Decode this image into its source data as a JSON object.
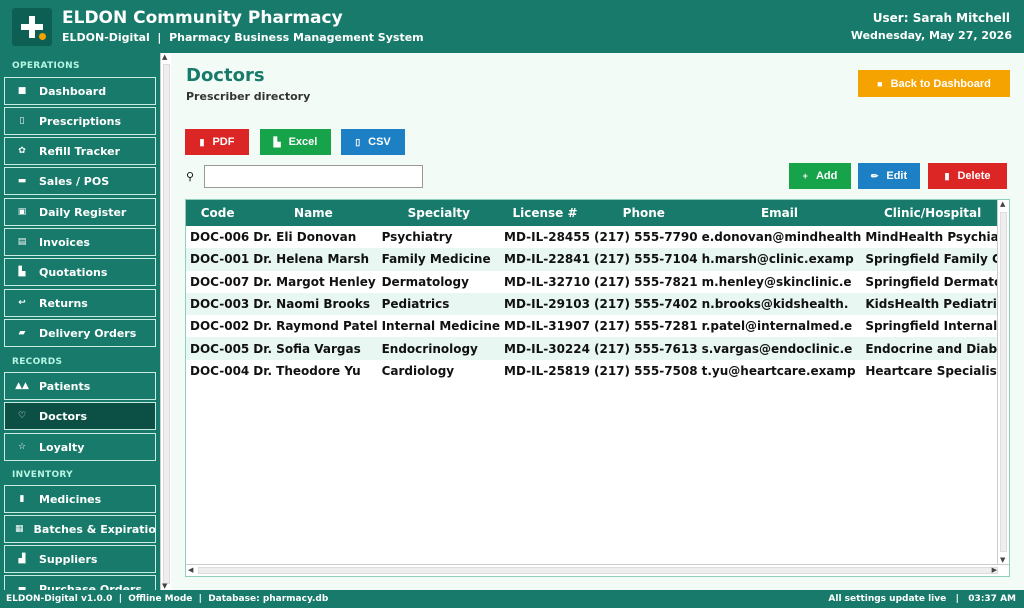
{
  "header": {
    "title": "ELDON Community Pharmacy",
    "subtitle": "ELDON-Digital  |  Pharmacy Business Management System",
    "user": "User: Sarah Mitchell",
    "date": "Wednesday, May 27, 2026",
    "logo_icon": "plus-cross-icon"
  },
  "sidebar": {
    "sections": [
      {
        "label": "OPERATIONS",
        "items": [
          {
            "icon": "home-icon",
            "glyph": "■",
            "label": "Dashboard"
          },
          {
            "icon": "clipboard-icon",
            "glyph": "▯",
            "label": "Prescriptions"
          },
          {
            "icon": "refill-icon",
            "glyph": "✿",
            "label": "Refill Tracker"
          },
          {
            "icon": "card-icon",
            "glyph": "▬",
            "label": "Sales / POS"
          },
          {
            "icon": "register-icon",
            "glyph": "▣",
            "label": "Daily Register"
          },
          {
            "icon": "invoice-icon",
            "glyph": "▤",
            "label": "Invoices"
          },
          {
            "icon": "quote-icon",
            "glyph": "▙",
            "label": "Quotations"
          },
          {
            "icon": "return-icon",
            "glyph": "↩",
            "label": "Returns"
          },
          {
            "icon": "truck-icon",
            "glyph": "▰",
            "label": "Delivery Orders"
          }
        ]
      },
      {
        "label": "RECORDS",
        "items": [
          {
            "icon": "users-icon",
            "glyph": "▲▲",
            "label": "Patients"
          },
          {
            "icon": "stethoscope-icon",
            "glyph": "♡",
            "label": "Doctors"
          },
          {
            "icon": "star-icon",
            "glyph": "☆",
            "label": "Loyalty"
          }
        ]
      },
      {
        "label": "INVENTORY",
        "items": [
          {
            "icon": "pill-icon",
            "glyph": "▮",
            "label": "Medicines"
          },
          {
            "icon": "batch-icon",
            "glyph": "▦",
            "label": "Batches & Expiratio"
          },
          {
            "icon": "factory-icon",
            "glyph": "▟",
            "label": "Suppliers"
          },
          {
            "icon": "cart-icon",
            "glyph": "▬",
            "label": "Purchase Orders"
          }
        ]
      }
    ],
    "active": "Doctors"
  },
  "main": {
    "title": "Doctors",
    "subtitle": "Prescriber directory",
    "back_label": "Back to Dashboard",
    "export": [
      {
        "label": "PDF",
        "color": "#dc2626"
      },
      {
        "label": "Excel",
        "color": "#16a34a"
      },
      {
        "label": "CSV",
        "color": "#1d7fc4"
      }
    ],
    "search": {
      "value": "",
      "placeholder": ""
    },
    "actions": [
      {
        "label": "Add",
        "glyph": "+",
        "color": "#16a34a"
      },
      {
        "label": "Edit",
        "glyph": "✏",
        "color": "#1d7fc4"
      },
      {
        "label": "Delete",
        "glyph": "▮",
        "color": "#dc2626"
      }
    ],
    "table": {
      "columns": [
        "Code",
        "Name",
        "Specialty",
        "License #",
        "Phone",
        "Email",
        "Clinic/Hospital"
      ],
      "rows": [
        [
          "DOC-006",
          "Dr. Eli Donovan",
          "Psychiatry",
          "MD-IL-28455",
          "(217) 555-7790",
          "e.donovan@mindhealth",
          "MindHealth Psychia"
        ],
        [
          "DOC-001",
          "Dr. Helena Marsh",
          "Family Medicine",
          "MD-IL-22841",
          "(217) 555-7104",
          "h.marsh@clinic.examp",
          "Springfield Family C"
        ],
        [
          "DOC-007",
          "Dr. Margot Henley",
          "Dermatology",
          "MD-IL-32710",
          "(217) 555-7821",
          "m.henley@skinclinic.e",
          "Springfield Dermato"
        ],
        [
          "DOC-003",
          "Dr. Naomi Brooks",
          "Pediatrics",
          "MD-IL-29103",
          "(217) 555-7402",
          "n.brooks@kidshealth.",
          "KidsHealth Pediatric"
        ],
        [
          "DOC-002",
          "Dr. Raymond Patel",
          "Internal Medicine",
          "MD-IL-31907",
          "(217) 555-7281",
          "r.patel@internalmed.e",
          "Springfield Internal"
        ],
        [
          "DOC-005",
          "Dr. Sofia Vargas",
          "Endocrinology",
          "MD-IL-30224",
          "(217) 555-7613",
          "s.vargas@endoclinic.e",
          "Endocrine and Diab"
        ],
        [
          "DOC-004",
          "Dr. Theodore Yu",
          "Cardiology",
          "MD-IL-25819",
          "(217) 555-7508",
          "t.yu@heartcare.examp",
          "Heartcare Specialist"
        ]
      ]
    }
  },
  "status": {
    "left": "ELDON-Digital v1.0.0  |  Offline Mode  |  Database: pharmacy.db",
    "right": "All settings update live   |   03:37 AM"
  }
}
